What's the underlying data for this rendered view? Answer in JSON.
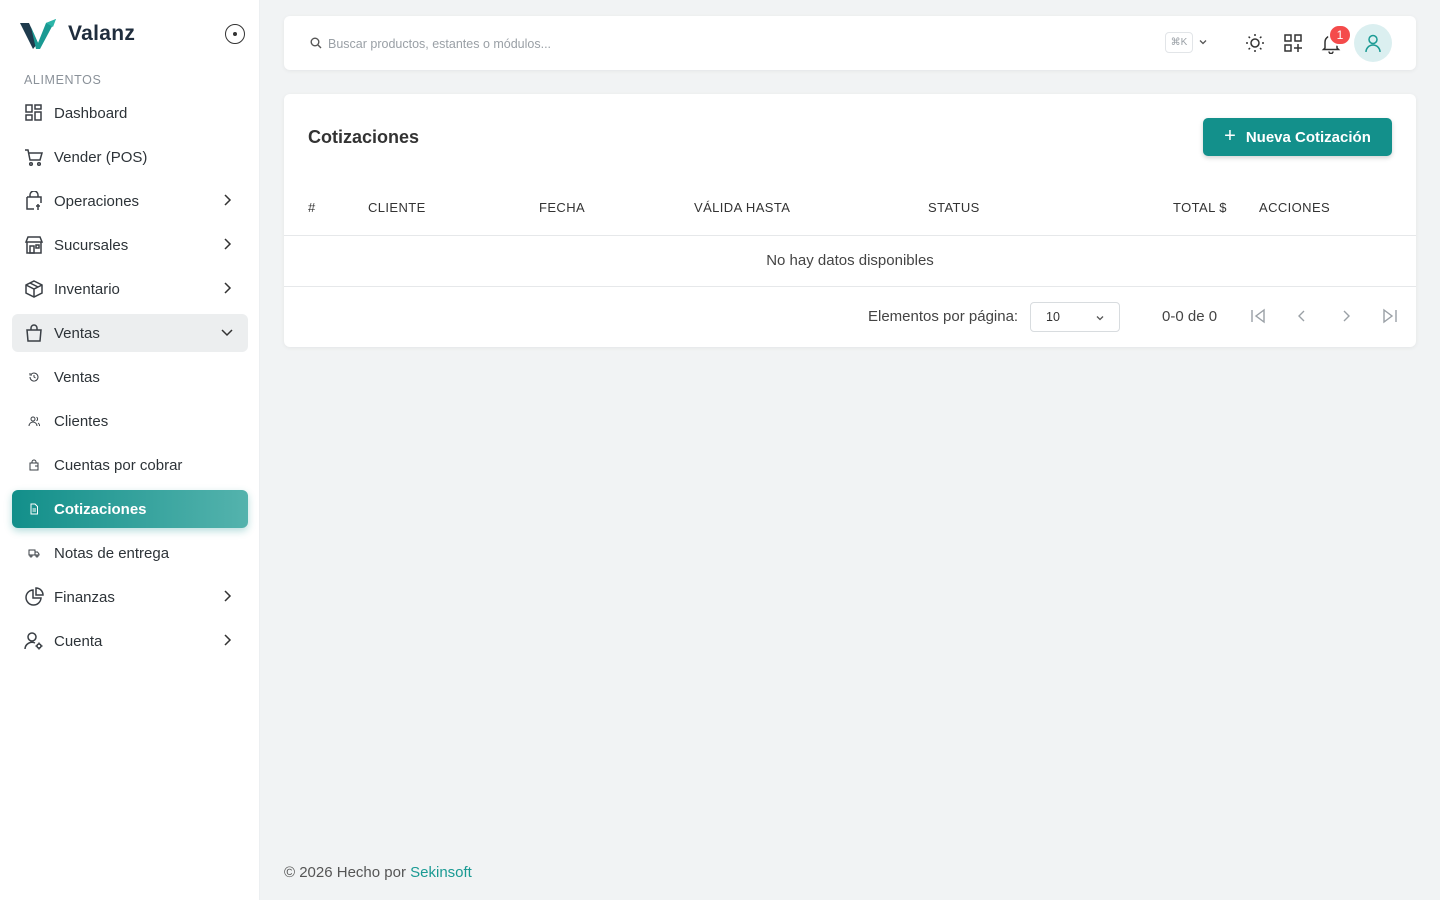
{
  "brand": {
    "name": "Valanz"
  },
  "sidebar": {
    "section_title": "ALIMENTOS",
    "items": [
      {
        "label": "Dashboard",
        "icon": "dashboard-icon"
      },
      {
        "label": "Vender (POS)",
        "icon": "cart-icon"
      },
      {
        "label": "Operaciones",
        "icon": "operations-icon"
      },
      {
        "label": "Sucursales",
        "icon": "store-icon"
      },
      {
        "label": "Inventario",
        "icon": "box-icon"
      },
      {
        "label": "Ventas",
        "icon": "shopping-bag-icon"
      },
      {
        "label": "Ventas",
        "icon": "history-icon"
      },
      {
        "label": "Clientes",
        "icon": "users-icon"
      },
      {
        "label": "Cuentas por cobrar",
        "icon": "wallet-icon"
      },
      {
        "label": "Cotizaciones",
        "icon": "document-icon"
      },
      {
        "label": "Notas de entrega",
        "icon": "truck-icon"
      },
      {
        "label": "Finanzas",
        "icon": "pie-chart-icon"
      },
      {
        "label": "Cuenta",
        "icon": "user-settings-icon"
      }
    ]
  },
  "topbar": {
    "search_placeholder": "Buscar productos, estantes o módulos...",
    "shortcut": "⌘K",
    "notification_count": "1"
  },
  "main": {
    "title": "Cotizaciones",
    "new_button_label": "Nueva Cotización",
    "table": {
      "columns": [
        "#",
        "CLIENTE",
        "FECHA",
        "VÁLIDA HASTA",
        "STATUS",
        "TOTAL $",
        "ACCIONES"
      ],
      "empty_message": "No hay datos disponibles"
    },
    "pagination": {
      "label": "Elementos por página:",
      "page_size": "10",
      "range": "0-0 de 0"
    }
  },
  "footer": {
    "text": "© 2026 Hecho por ",
    "link": "Sekinsoft"
  },
  "colors": {
    "accent": "#13908b",
    "accent_light": "#54b3ad",
    "badge": "#f44b4b",
    "background": "#f1f3f4"
  }
}
